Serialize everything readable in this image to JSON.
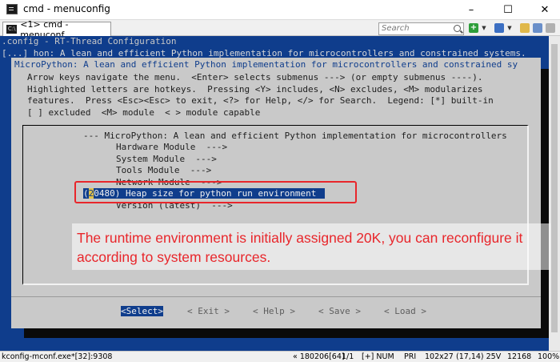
{
  "window": {
    "title": "cmd - menuconfig",
    "minimize": "–",
    "maximize": "☐",
    "close": "✕"
  },
  "tabs": [
    {
      "label": "<1> cmd - menuconf"
    }
  ],
  "toolbar": {
    "search_placeholder": "Search",
    "add": "+",
    "dropdown": "▼"
  },
  "console": {
    "line1": ".config - RT-Thread Configuration",
    "line2": "[...] hon: A lean and efficient Python implementation for microcontrollers and constrained systems."
  },
  "dialog": {
    "title": "MicroPython: A lean and efficient Python implementation for microcontrollers and constrained sy",
    "help": [
      "Arrow keys navigate the menu.  <Enter> selects submenus ---> (or empty submenus ----).",
      "Highlighted letters are hotkeys.  Pressing <Y> includes, <N> excludes, <M> modularizes",
      "features.  Press <Esc><Esc> to exit, <?> for Help, </> for Search.  Legend: [*] built-in",
      "[ ] excluded  <M> module  < > module capable"
    ],
    "menu_header": "--- MicroPython: A lean and efficient Python implementation for microcontrollers",
    "items": [
      {
        "label": "Hardware Module  --->"
      },
      {
        "label": "System Module  --->"
      },
      {
        "label": "Tools Module  --->"
      },
      {
        "label": "Network Module  --->"
      }
    ],
    "selected_open": "(",
    "selected_cursor": "2",
    "selected_rest": "0480) Heap size for python run environment",
    "version_item": "Version (latest)  --->",
    "buttons": {
      "select": "<Select>",
      "exit": "< Exit >",
      "help": "< Help >",
      "save": "< Save >",
      "load": "< Load >"
    }
  },
  "annotation": {
    "text": "The runtime environment is initially assigned 20K, you can reconfigure it according to system resources."
  },
  "statusbar": {
    "process": "kconfig-mconf.exe*[32]:9308",
    "pos": "« 180206[64]",
    "page": "1/1",
    "mode": "[+] NUM",
    "pri": "PRI",
    "size": "102x27",
    "cursor": "(17,14) 25V",
    "mem": "12168",
    "pct": "100%"
  },
  "colors": {
    "console_bg": "#0f3d8c",
    "dialog_bg": "#c9c9c9",
    "annotation": "#e8262b"
  }
}
